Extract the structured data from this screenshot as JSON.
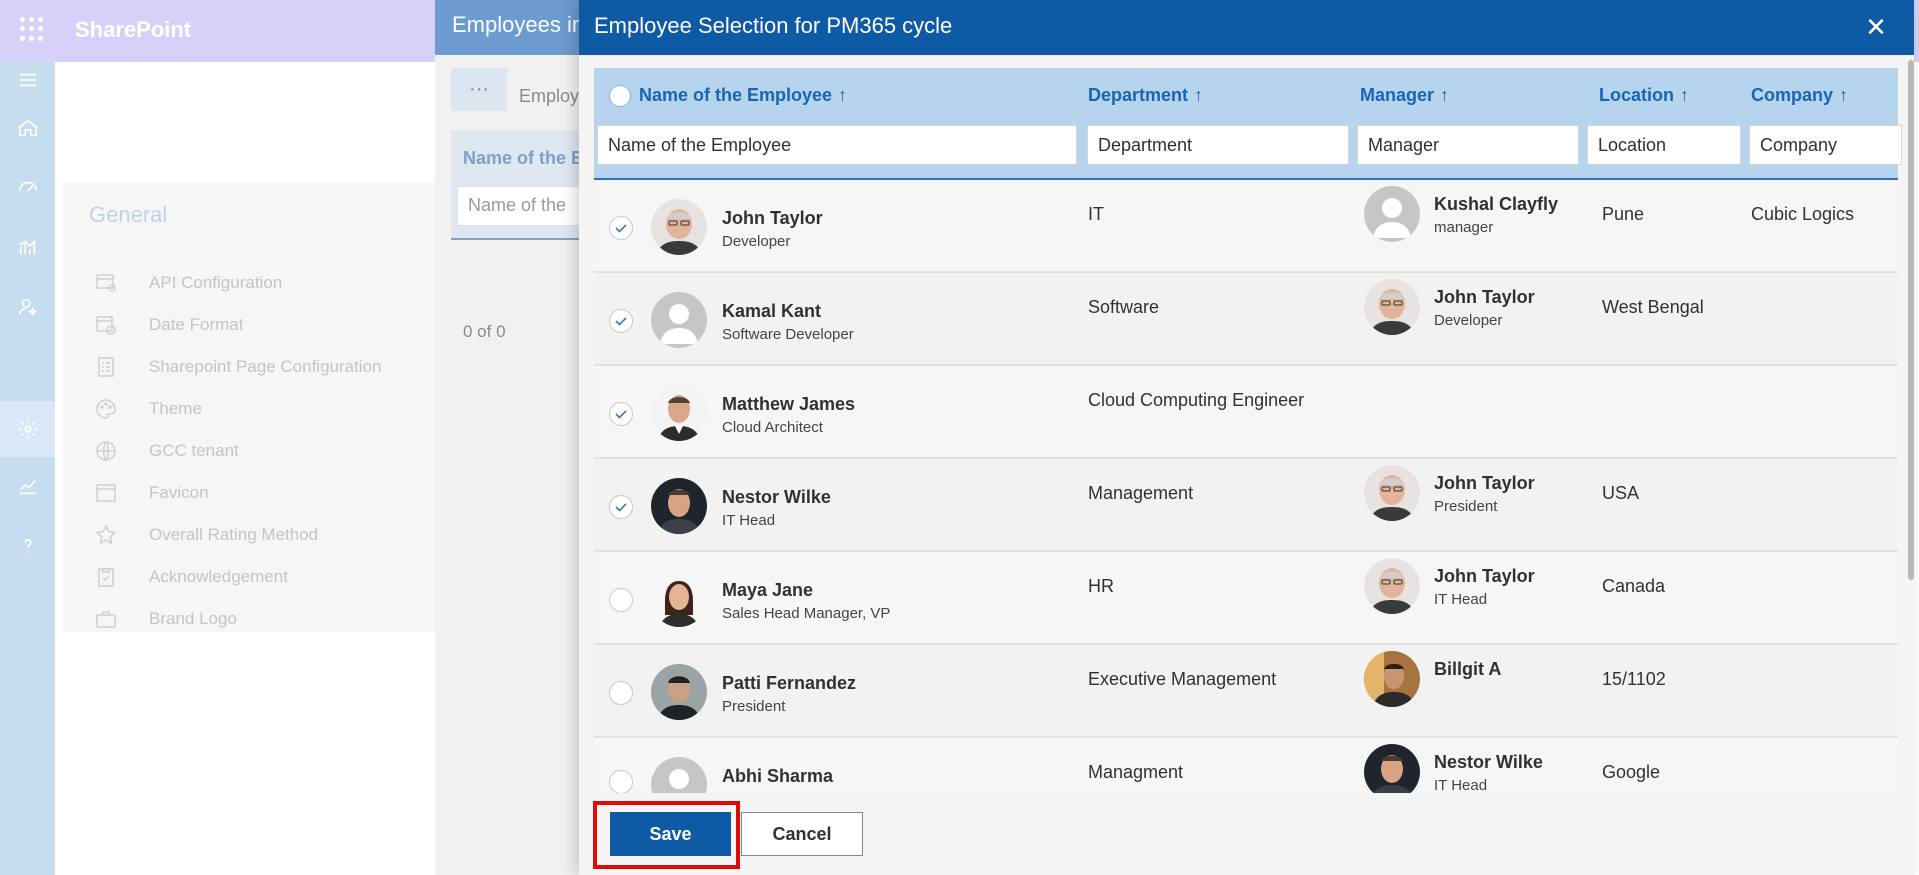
{
  "sharepoint": {
    "brand": "SharePoint",
    "rail_icons": [
      "menu-icon",
      "home-icon",
      "speedometer-icon",
      "analytics-icon",
      "user-settings-icon",
      "gear-icon",
      "trend-icon",
      "help-icon"
    ]
  },
  "settings": {
    "title": "General",
    "items": [
      {
        "label": "API Configuration",
        "icon": "api-config-icon"
      },
      {
        "label": "Date Format",
        "icon": "calendar-clock-icon"
      },
      {
        "label": "Sharepoint Page Configuration",
        "icon": "page-config-icon"
      },
      {
        "label": "Theme",
        "icon": "palette-icon"
      },
      {
        "label": "GCC tenant",
        "icon": "globe-icon"
      },
      {
        "label": "Favicon",
        "icon": "window-icon"
      },
      {
        "label": "Overall Rating Method",
        "icon": "star-icon"
      },
      {
        "label": "Acknowledgement",
        "icon": "clipboard-icon"
      },
      {
        "label": "Brand Logo",
        "icon": "briefcase-icon"
      }
    ]
  },
  "middle_panel": {
    "title": "Employees in",
    "more_label": "···",
    "tab_label": "Employ",
    "column_label": "Name of the E",
    "filter_placeholder": "Name of the",
    "count_text": "0 of 0"
  },
  "dialog": {
    "title": "Employee Selection for PM365 cycle",
    "close_label": "✕",
    "columns": [
      {
        "label": "Name of the Employee",
        "sort": "↑",
        "filter_placeholder": "Name of the Employee"
      },
      {
        "label": "Department",
        "sort": "↑",
        "filter_placeholder": "Department"
      },
      {
        "label": "Manager",
        "sort": "↑",
        "filter_placeholder": "Manager"
      },
      {
        "label": "Location",
        "sort": "↑",
        "filter_placeholder": "Location"
      },
      {
        "label": "Company",
        "sort": "↑",
        "filter_placeholder": "Company"
      }
    ],
    "rows": [
      {
        "selected": true,
        "name": "John Taylor",
        "role": "Developer",
        "department": "IT",
        "manager_name": "Kushal Clayfly",
        "manager_role": "manager",
        "location": "Pune",
        "company": "Cubic Logics"
      },
      {
        "selected": true,
        "name": "Kamal Kant",
        "role": "Software Developer",
        "department": "Software",
        "manager_name": "John Taylor",
        "manager_role": "Developer",
        "location": "West Bengal",
        "company": ""
      },
      {
        "selected": true,
        "name": "Matthew James",
        "role": "Cloud Architect",
        "department": "Cloud Computing Engineer",
        "manager_name": "",
        "manager_role": "",
        "location": "",
        "company": ""
      },
      {
        "selected": true,
        "name": "Nestor Wilke",
        "role": "IT Head",
        "department": "Management",
        "manager_name": "John Taylor",
        "manager_role": "President",
        "location": "USA",
        "company": ""
      },
      {
        "selected": false,
        "name": "Maya Jane",
        "role": "Sales Head Manager, VP",
        "department": "HR",
        "manager_name": "John Taylor",
        "manager_role": "IT Head",
        "location": "Canada",
        "company": ""
      },
      {
        "selected": false,
        "name": "Patti Fernandez",
        "role": "President",
        "department": "Executive Management",
        "manager_name": "Billgit A",
        "manager_role": "",
        "location": "15/1102",
        "company": ""
      },
      {
        "selected": false,
        "name": "Abhi Sharma",
        "role": "",
        "department": "Managment",
        "manager_name": "Nestor Wilke",
        "manager_role": "IT Head",
        "location": "Google",
        "company": ""
      }
    ],
    "save_label": "Save",
    "cancel_label": "Cancel"
  },
  "colors": {
    "dialog_header": "#0f5aa5",
    "grid_header": "#b7d4ef",
    "column_text": "#1765b4",
    "save_highlight": "#e00a0a"
  }
}
